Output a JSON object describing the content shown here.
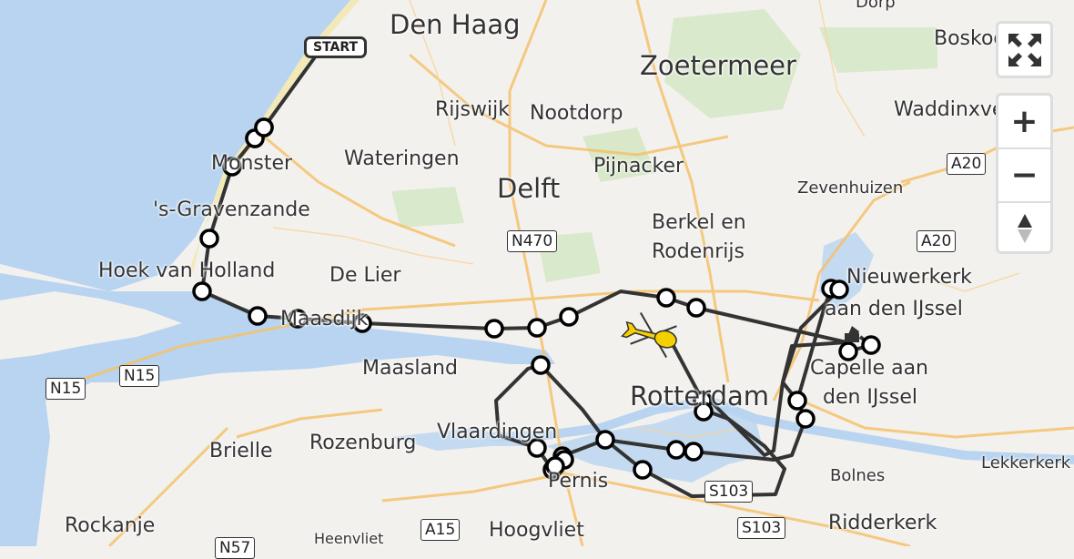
{
  "map": {
    "places": [
      {
        "name": "Den Haag",
        "size": "big"
      },
      {
        "name": "Zoetermeer",
        "size": "big"
      },
      {
        "name": "Rijswijk",
        "size": "med"
      },
      {
        "name": "Nootdorp",
        "size": "med"
      },
      {
        "name": "Wateringen",
        "size": "med"
      },
      {
        "name": "Monster",
        "size": "med"
      },
      {
        "name": "Pijnacker",
        "size": "med"
      },
      {
        "name": "Delft",
        "size": "big"
      },
      {
        "name": "'s-Gravenzande",
        "size": "med"
      },
      {
        "name": "Berkel en",
        "size": "med"
      },
      {
        "name": "Rodenrijs",
        "size": "med"
      },
      {
        "name": "Hoek van Holland",
        "size": "med"
      },
      {
        "name": "De Lier",
        "size": "med"
      },
      {
        "name": "Maasdijk",
        "size": "med"
      },
      {
        "name": "Maasland",
        "size": "med"
      },
      {
        "name": "Rotterdam",
        "size": "big"
      },
      {
        "name": "Vlaardingen",
        "size": "med"
      },
      {
        "name": "Pernis",
        "size": "med"
      },
      {
        "name": "Brielle",
        "size": "med"
      },
      {
        "name": "Rozenburg",
        "size": "med"
      },
      {
        "name": "Rockanje",
        "size": "med"
      },
      {
        "name": "Hoogvliet",
        "size": "med"
      },
      {
        "name": "Heenvliet",
        "size": "med"
      },
      {
        "name": "Nieuwerkerk",
        "size": "med"
      },
      {
        "name": "aan den IJssel",
        "size": "med"
      },
      {
        "name": "Capelle aan",
        "size": "med"
      },
      {
        "name": "den IJssel",
        "size": "med"
      },
      {
        "name": "Zevenhuizen",
        "size": "med"
      },
      {
        "name": "Waddinxveen",
        "size": "med"
      },
      {
        "name": "Boskoop",
        "size": "med"
      },
      {
        "name": "Dorp",
        "size": "med"
      },
      {
        "name": "Bolnes",
        "size": "med"
      },
      {
        "name": "Lekkerkerk",
        "size": "med"
      },
      {
        "name": "Ridderkerk",
        "size": "med"
      }
    ],
    "road_shields": [
      "A20",
      "A20",
      "N470",
      "N15",
      "N15",
      "A15",
      "S103",
      "S103",
      "N57"
    ],
    "route": {
      "start_label": "START",
      "line_color": "#333333",
      "stop_count": 33
    },
    "vehicle": {
      "type": "helicopter-icon",
      "color": "#f5d000"
    },
    "destination": {
      "type": "destination-marker-icon"
    }
  },
  "controls": {
    "fullscreen": "fullscreen-icon",
    "zoom_in": "+",
    "zoom_out": "−",
    "compass": "compass-icon"
  },
  "colors": {
    "water": "#b6d3ef",
    "land": "#f3f1ee",
    "road": "#f7c46a",
    "park": "#d4e6c3"
  }
}
